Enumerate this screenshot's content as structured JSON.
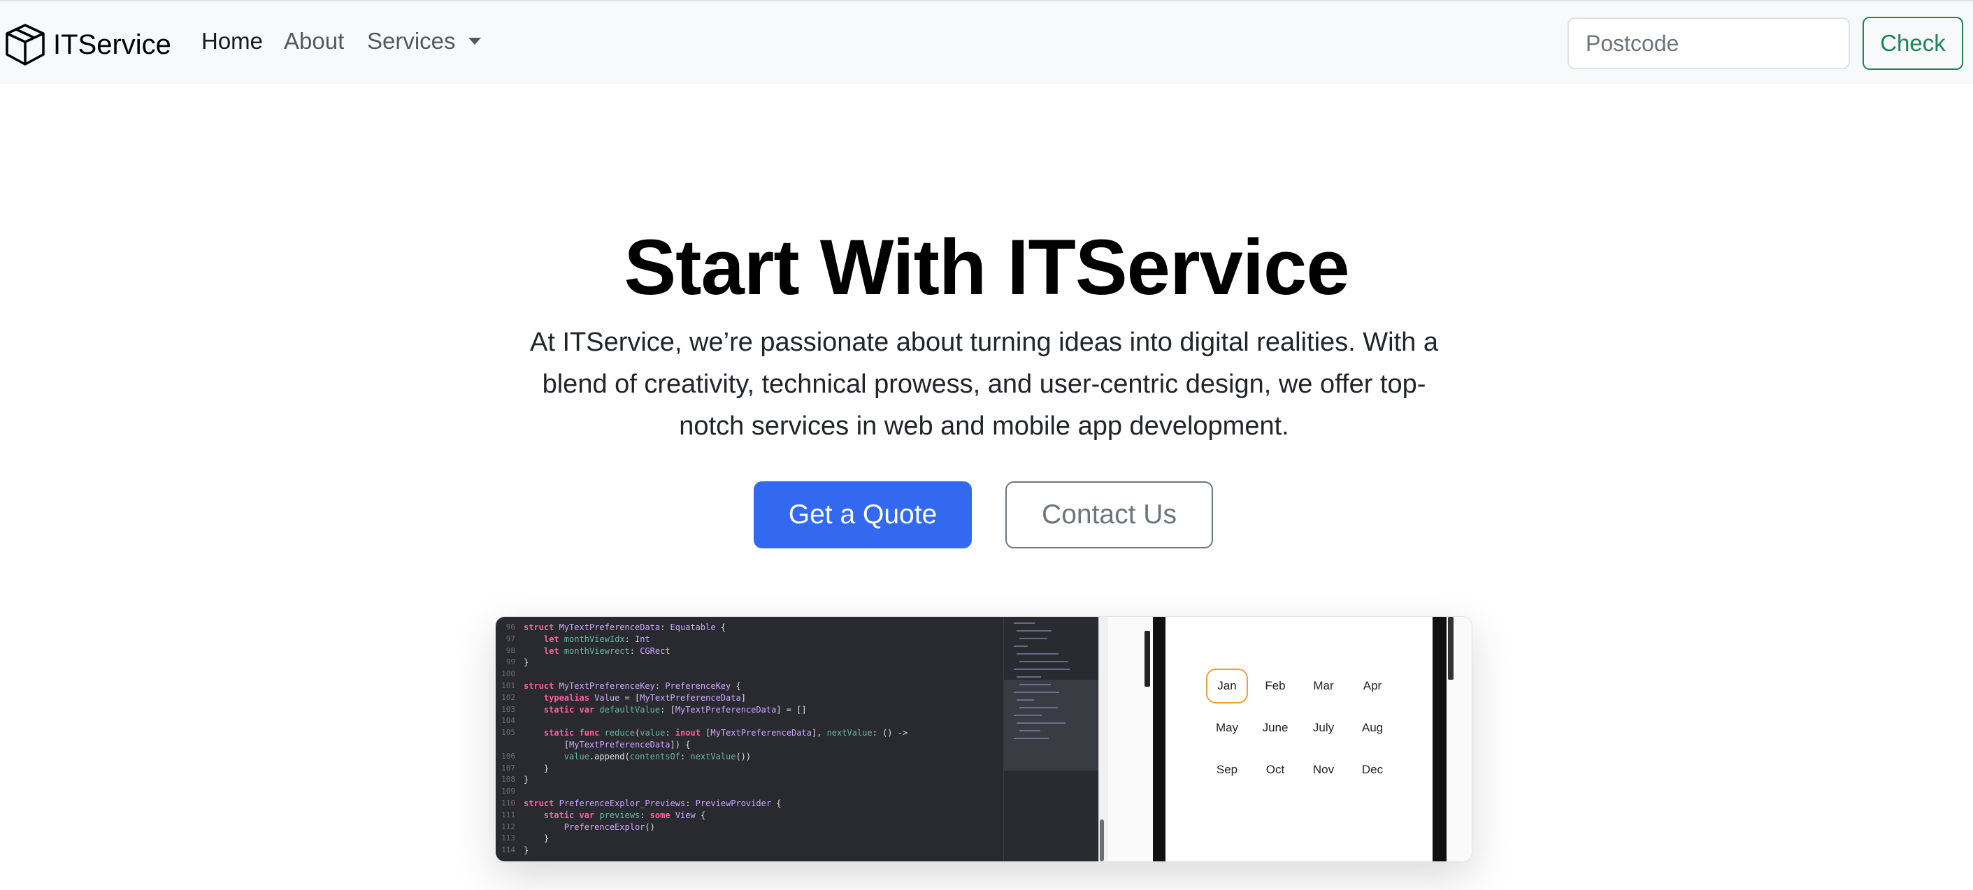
{
  "navbar": {
    "brand": "ITService",
    "links": {
      "home": "Home",
      "about": "About",
      "services": "Services"
    },
    "search_placeholder": "Postcode",
    "check_label": "Check"
  },
  "hero": {
    "title": "Start With ITService",
    "lead": "At ITService, we’re passionate about turning ideas into digital realities. With a blend of creativity, technical prowess, and user-centric design, we offer top-notch services in web and mobile app development.",
    "primary_button": "Get a Quote",
    "secondary_button": "Contact Us"
  },
  "screenshot": {
    "code": [
      {
        "n": "96",
        "t": "struct MyTextPreferenceData: Equatable {"
      },
      {
        "n": "97",
        "t": "    let monthViewIdx: Int"
      },
      {
        "n": "98",
        "t": "    let monthViewrect: CGRect"
      },
      {
        "n": "99",
        "t": "}"
      },
      {
        "n": "100",
        "t": ""
      },
      {
        "n": "101",
        "t": "struct MyTextPreferenceKey: PreferenceKey {"
      },
      {
        "n": "102",
        "t": "    typealias Value = [MyTextPreferenceData]"
      },
      {
        "n": "103",
        "t": "    static var defaultValue: [MyTextPreferenceData] = []"
      },
      {
        "n": "104",
        "t": ""
      },
      {
        "n": "105",
        "t": "    static func reduce(value: inout [MyTextPreferenceData], nextValue: () ->"
      },
      {
        "n": "",
        "t": "        [MyTextPreferenceData]) {"
      },
      {
        "n": "106",
        "t": "        value.append(contentsOf: nextValue())"
      },
      {
        "n": "107",
        "t": "    }"
      },
      {
        "n": "108",
        "t": "}"
      },
      {
        "n": "109",
        "t": ""
      },
      {
        "n": "110",
        "t": "struct PreferenceExplor_Previews: PreviewProvider {"
      },
      {
        "n": "111",
        "t": "    static var previews: some View {"
      },
      {
        "n": "112",
        "t": "        PreferenceExplor()"
      },
      {
        "n": "113",
        "t": "    }"
      },
      {
        "n": "114",
        "t": "}"
      }
    ],
    "months": [
      "Jan",
      "Feb",
      "Mar",
      "Apr",
      "May",
      "June",
      "July",
      "Aug",
      "Sep",
      "Oct",
      "Nov",
      "Dec"
    ],
    "selected_month": "Jan"
  },
  "colors": {
    "primary": "#3269f0",
    "success": "#198754",
    "secondary": "#6c757d",
    "highlight": "#f0a030"
  }
}
